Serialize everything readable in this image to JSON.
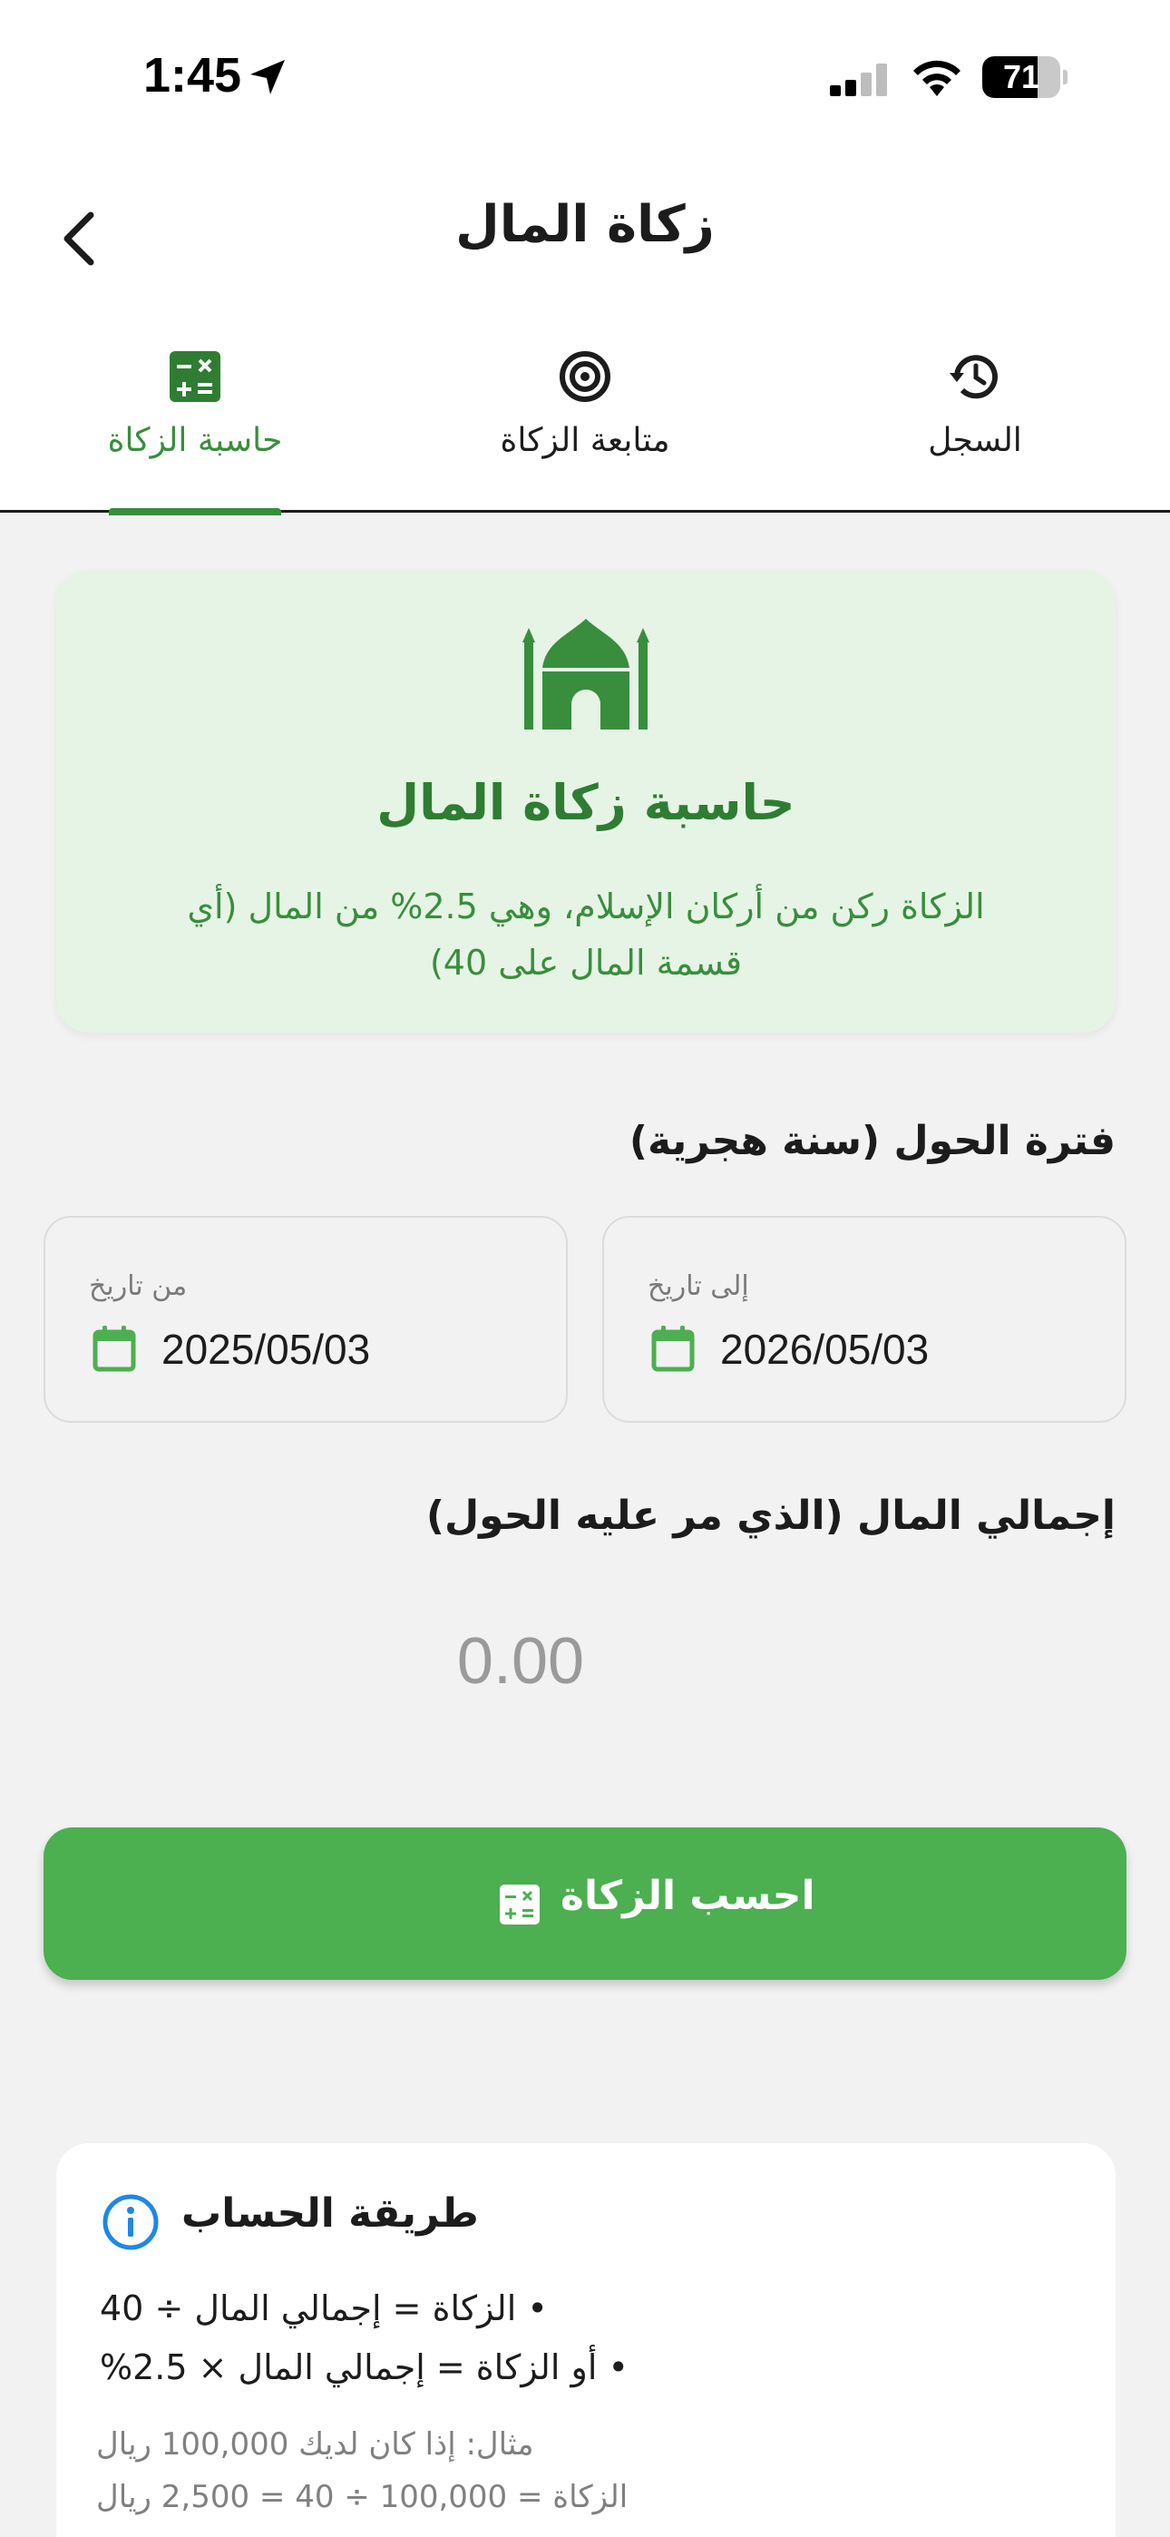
{
  "status_bar": {
    "time": "1:45",
    "battery": "71",
    "battery_level": 0.71
  },
  "app_bar": {
    "title": "زكاة المال"
  },
  "tabs": [
    {
      "label": "حاسبة الزكاة",
      "icon": "calculator-icon",
      "active": true
    },
    {
      "label": "متابعة الزكاة",
      "icon": "target-icon",
      "active": false
    },
    {
      "label": "السجل",
      "icon": "history-icon",
      "active": false
    }
  ],
  "hero": {
    "icon": "mosque-icon",
    "title": "حاسبة زكاة المال",
    "description": "الزكاة ركن من أركان الإسلام، وهي 2.5% من المال (أي قسمة المال على 40)"
  },
  "period": {
    "label": "فترة الحول (سنة هجرية)",
    "from_caption": "من تاريخ",
    "from_value": "2025/05/03",
    "to_caption": "إلى تاريخ",
    "to_value": "2026/05/03"
  },
  "amount": {
    "label": "إجمالي المال (الذي مر عليه الحول)",
    "value": "0.00"
  },
  "calculate_button": {
    "label": "احسب الزكاة"
  },
  "method": {
    "title": "طريقة الحساب",
    "lines": [
      "• الزكاة = إجمالي المال ÷ 40",
      "• أو الزكاة = إجمالي المال × 2.5%"
    ],
    "example_lines": [
      "مثال: إذا كان لديك 100,000 ريال",
      "الزكاة = 100,000 ÷ 40 = 2,500 ريال"
    ]
  },
  "colors": {
    "primary": "#4caf50",
    "primary_dark": "#2e7d32",
    "hero_bg": "#e6f4e6",
    "info_blue": "#1e88e5"
  }
}
